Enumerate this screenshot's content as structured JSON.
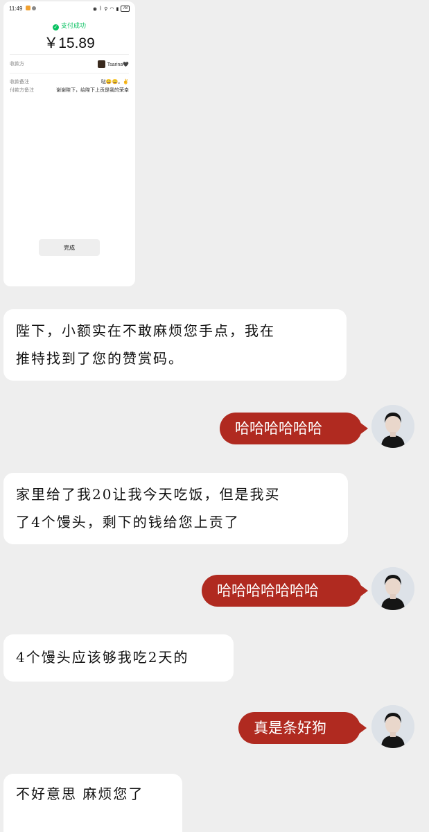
{
  "payment": {
    "status_bar": {
      "time": "11:49",
      "battery": "78"
    },
    "success_label": "支付成功",
    "amount": "￥15.89",
    "payee_label": "收款方",
    "payee_name": "Tsarina🖤",
    "payee_note_label": "收款备注",
    "payee_note": "哒😄😄。✌",
    "payer_note_label": "付款方备注",
    "payer_note": "谢谢陛下，给陛下上贡是我的荣幸",
    "done_label": "完成",
    "accent_color": "#07c160"
  },
  "messages": [
    {
      "side": "left",
      "lines": [
        "陛下，小额实在不敢麻烦您手点，我在",
        "推特找到了您的赞赏码。"
      ]
    },
    {
      "side": "right",
      "text": "哈哈哈哈哈哈"
    },
    {
      "side": "left",
      "lines": [
        "家里给了我20让我今天吃饭，但是我买",
        "了4个馒头，剩下的钱给您上贡了"
      ]
    },
    {
      "side": "right",
      "text": "哈哈哈哈哈哈哈"
    },
    {
      "side": "left",
      "lines": [
        "4个馒头应该够我吃2天的"
      ]
    },
    {
      "side": "right",
      "text": "真是条好狗"
    },
    {
      "side": "left",
      "lines": [
        "不好意思 麻烦您了"
      ]
    }
  ],
  "colors": {
    "right_bubble": "#b02a20",
    "background": "#eeeeee"
  },
  "icons": [
    "check-icon",
    "avatar"
  ]
}
